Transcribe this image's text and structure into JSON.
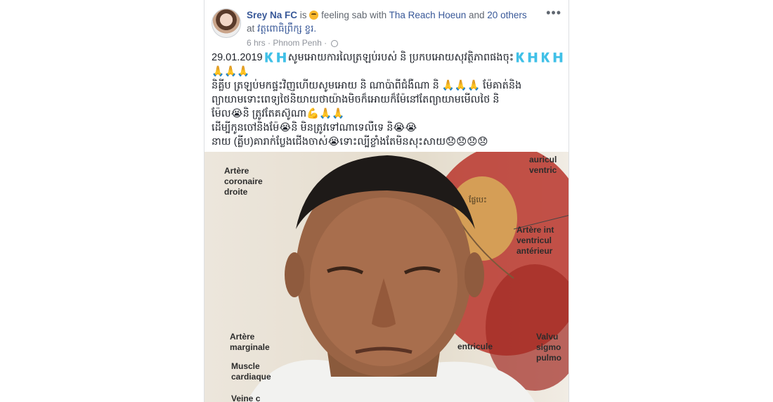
{
  "post": {
    "author": "Srey Na FC",
    "is_word": "is",
    "feeling": "feeling sab with",
    "with_person": "Tha Reach Hoeun",
    "and_word": "and",
    "others": "20 others",
    "at_word": "at",
    "location": "វត្តពោធិព្រឹក្ស ខ្វរ.",
    "time": "6 hrs",
    "dot": "·",
    "place": "Phnom Penh",
    "dot2": "·",
    "more_label": "•••",
    "lines": [
      "29.01.2019🇰🇭សូមអោយការលៃត្រឡប់របស់ និ ប្រកបអោយសុវត្ថិភាពផងចុះ🇰🇭🇰🇭",
      "🙏🙏🙏",
      "និគ្លីប ត្រឡប់មកផ្ទះវិញហើយសូមអោយ និ ណាប៉ាពីជំងឺណា និ 🙏🙏🙏 ម៉ែគាត់និង",
      "ព្យាយាមទោះពេទ្យថៃនិយាយថាយ៉ាងមិចក៏អោយក៏ម៉ែនៅតែព្យាយាមមើលថៃ និ",
      "ម៉ែល😭និ ត្រូវតែគស៊ូណា💪🙏🙏",
      "ដើម្បីកូនចៅនិងម៉ែ😭និ មិនត្រូវទៅណាទេលឺទេ និ😭😭",
      "នាយ (គ្លីប)គារាក់ប្លែងជើងចាស់😭ទោះល្បីខ្លាំងតែមិនសុះសាយ😞😞😞😞"
    ]
  },
  "photo": {
    "labels": {
      "artere_coronaire": [
        "Artère",
        "coronaire",
        "droite"
      ],
      "auricule": [
        "auricul",
        "ventric"
      ],
      "artere_inter": [
        "Artère int",
        "ventricul",
        "antérieur"
      ],
      "artere_marginale": [
        "Artère",
        "marginale"
      ],
      "muscle": [
        "Muscle",
        "cardiaque"
      ],
      "veine": "Veine c",
      "ventricule": "entricule",
      "valvule": [
        "Valvu",
        "sigmo",
        "pulmo"
      ],
      "bubble": "ផ្លែបេះ"
    }
  },
  "colors": {
    "link": "#385898",
    "text": "#1d2129",
    "meta": "#90949c"
  }
}
